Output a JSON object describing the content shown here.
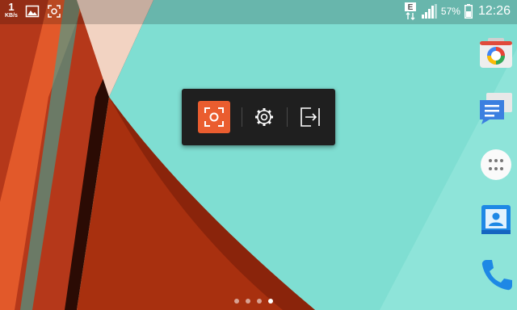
{
  "status_bar": {
    "net_speed_value": "1",
    "net_speed_unit": "KB/s",
    "left_icons": [
      "gallery-icon",
      "screenshot-icon"
    ],
    "right_icons": [
      "data-e-icon",
      "signal-icon"
    ],
    "network_type": "E",
    "battery_percent": "57%",
    "time": "12:26"
  },
  "capture_toolbar": {
    "buttons": [
      {
        "name": "capture-region-button",
        "icon": "screenshot-frame-icon",
        "active": true
      },
      {
        "name": "settings-button",
        "icon": "gear-icon"
      },
      {
        "name": "exit-button",
        "icon": "exit-icon"
      }
    ],
    "active_color": "#ea5d2f"
  },
  "dock": {
    "apps": [
      {
        "name": "camera-app",
        "icon": "camera-icon"
      },
      {
        "name": "messaging-app",
        "icon": "messages-icon"
      },
      {
        "name": "app-drawer",
        "icon": "app-drawer-icon"
      },
      {
        "name": "contacts-app",
        "icon": "contacts-icon"
      },
      {
        "name": "phone-app",
        "icon": "phone-icon"
      }
    ]
  },
  "home_pages": {
    "count": 4,
    "active": 4
  },
  "colors": {
    "teal": "#7fded2",
    "red": "#c5401e",
    "orange": "#e2592a",
    "peach": "#f2d3c2"
  }
}
